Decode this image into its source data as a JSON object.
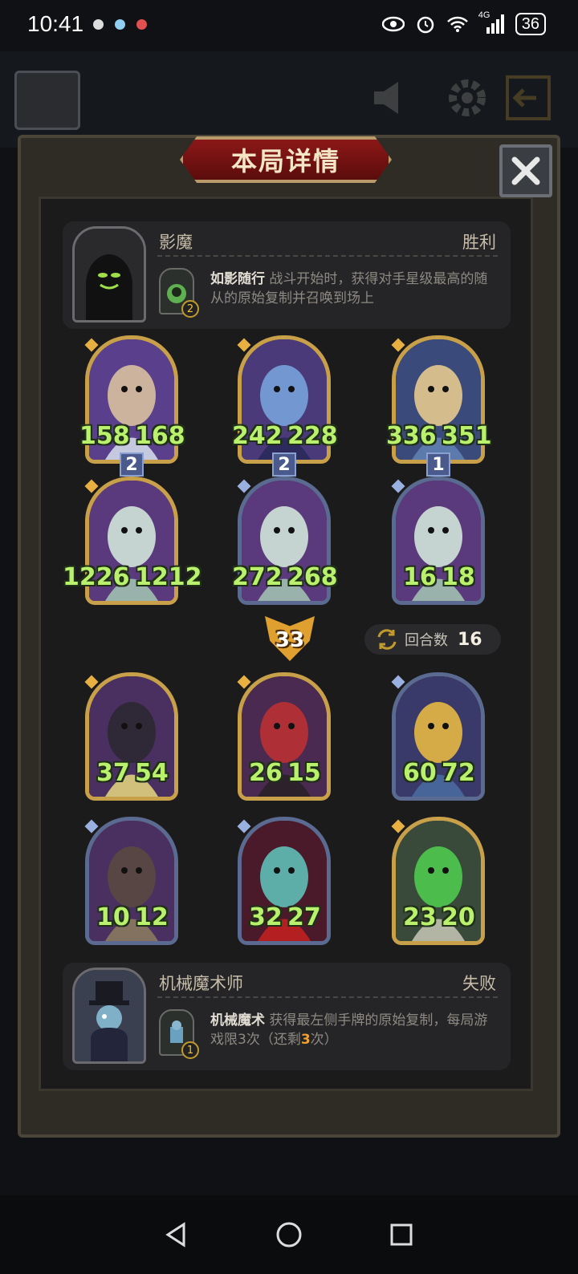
{
  "status_bar": {
    "time": "10:41",
    "network": "4G",
    "battery": "36"
  },
  "dialog": {
    "title": "本局详情",
    "close_icon": "close-icon"
  },
  "top_player": {
    "name": "影魔",
    "result": "胜利",
    "skill_level": "2",
    "skill_name": "如影随行",
    "skill_desc": "战斗开始时，获得对手星级最高的随从的原始复制并召唤到场上"
  },
  "bottom_player": {
    "name": "机械魔术师",
    "result": "失败",
    "skill_level": "1",
    "skill_name": "机械魔术",
    "skill_desc_1": "获得最左侧手牌的原始复制，每局游戏限3次（还剩",
    "skill_remaining": "3",
    "skill_desc_2": "次）"
  },
  "top_cards": [
    {
      "attack": "158",
      "health": "168"
    },
    {
      "attack": "242",
      "health": "228"
    },
    {
      "attack": "336",
      "health": "351"
    },
    {
      "attack": "1226",
      "health": "1212",
      "level": "2"
    },
    {
      "attack": "272",
      "health": "268",
      "level": "2"
    },
    {
      "attack": "16",
      "health": "18",
      "level": "1"
    }
  ],
  "bottom_cards": [
    {
      "attack": "37",
      "health": "54"
    },
    {
      "attack": "26",
      "health": "15"
    },
    {
      "attack": "60",
      "health": "72"
    },
    {
      "attack": "10",
      "health": "12"
    },
    {
      "attack": "32",
      "health": "27"
    },
    {
      "attack": "23",
      "health": "20"
    }
  ],
  "damage_badge": "33",
  "rounds": {
    "label": "回合数",
    "value": "16"
  },
  "colors": {
    "accent_gold": "#c9a04a",
    "title_red": "#8c1818",
    "stat_green": "#b9f06c",
    "highlight_orange": "#f0a030"
  }
}
